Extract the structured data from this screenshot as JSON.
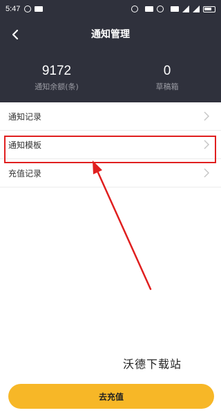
{
  "status_bar": {
    "time": "5:47"
  },
  "header": {
    "title": "通知管理",
    "stats": [
      {
        "value": "9172",
        "label": "通知余额(条)"
      },
      {
        "value": "0",
        "label": "草稿箱"
      }
    ]
  },
  "menu": {
    "items": [
      {
        "label": "通知记录"
      },
      {
        "label": "通知模板"
      },
      {
        "label": "充值记录"
      }
    ]
  },
  "annotation": {
    "highlight_color": "#e01f1f"
  },
  "watermark": "沃德下载站",
  "bottom_button": {
    "label": "去充值",
    "color": "#f7b727"
  },
  "colors": {
    "header_bg": "#2f313c",
    "accent": "#f7b727"
  }
}
